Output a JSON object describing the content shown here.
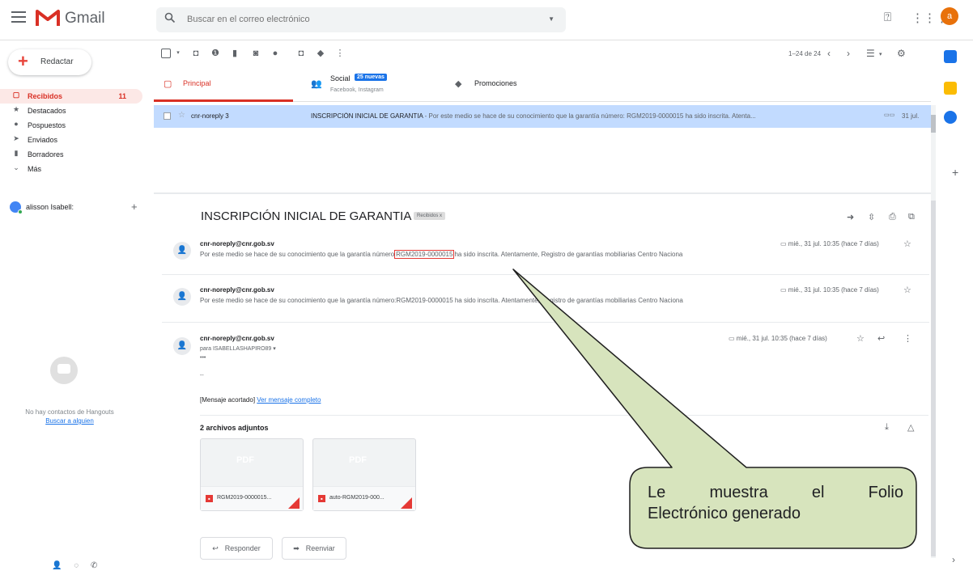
{
  "header": {
    "logo_text": "Gmail",
    "search_placeholder": "Buscar en el correo electrónico",
    "avatar_letter": "a"
  },
  "sidebar": {
    "compose_label": "Redactar",
    "items": [
      {
        "label": "Recibidos",
        "count": "11",
        "icon": "inbox-icon"
      },
      {
        "label": "Destacados",
        "icon": "star-icon"
      },
      {
        "label": "Pospuestos",
        "icon": "clock-icon"
      },
      {
        "label": "Enviados",
        "icon": "send-icon"
      },
      {
        "label": "Borradores",
        "icon": "draft-icon"
      },
      {
        "label": "Más",
        "icon": "chevron-down-icon"
      }
    ],
    "hangouts_user": "alisson Isabell:",
    "hangouts_empty": "No hay contactos de Hangouts",
    "hangouts_link": "Buscar a alguien"
  },
  "toolbar": {
    "count": "1–24 de 24"
  },
  "tabs": [
    {
      "label": "Principal",
      "icon": "inbox-tab-icon"
    },
    {
      "label": "Social",
      "badge": "25 nuevas",
      "sub": "Facebook, Instagram",
      "icon": "people-icon"
    },
    {
      "label": "Promociones",
      "icon": "tag-icon"
    }
  ],
  "message_list": [
    {
      "sender": "cnr-noreply 3",
      "subject": "INSCRIPCIÓN INICIAL DE GARANTIA",
      "snippet": " - Por este medio se hace de su conocimiento que la garantía número: RGM2019-0000015 ha sido inscrita. Atenta...",
      "date": "31 jul."
    }
  ],
  "thread": {
    "title": "INSCRIPCIÓN INICIAL DE GARANTIA",
    "label": "Recibidos x",
    "messages": [
      {
        "from": "cnr-noreply@cnr.gob.sv",
        "body_pre": "Por este medio se hace de su conocimiento que la garantía número",
        "folio": "RGM2019-0000015",
        "body_post": "ha sido inscrita. Atentamente, Registro de garantías mobiliarias Centro Naciona",
        "date": "mié., 31 jul. 10:35 (hace 7 días)"
      },
      {
        "from": "cnr-noreply@cnr.gob.sv",
        "body": "Por este medio se hace de su conocimiento que la garantía número:RGM2019-0000015 ha sido inscrita. Atentamente, Registro de garantías mobiliarias Centro Naciona",
        "date": "mié., 31 jul. 10:35 (hace 7 días)"
      },
      {
        "from": "cnr-noreply@cnr.gob.sv",
        "to": "para ISABELLASHAPIRO89",
        "date": "mié., 31 jul. 10:35 (hace 7 días)"
      }
    ],
    "clipped_text": "[Mensaje acortado]",
    "clipped_link": "Ver mensaje completo",
    "attachments_title": "2 archivos adjuntos",
    "attachments": [
      {
        "name": "RGM2019-0000015..."
      },
      {
        "name": "auto-RGM2019-000..."
      }
    ],
    "pdf_placeholder": "PDF",
    "reply_label": "Responder",
    "forward_label": "Reenviar"
  },
  "callout": {
    "line1": "Le muestra el Folio",
    "line2": "Electrónico generado",
    "fill_color": "#d7e4bd",
    "stroke_color": "#1f1f1f"
  }
}
